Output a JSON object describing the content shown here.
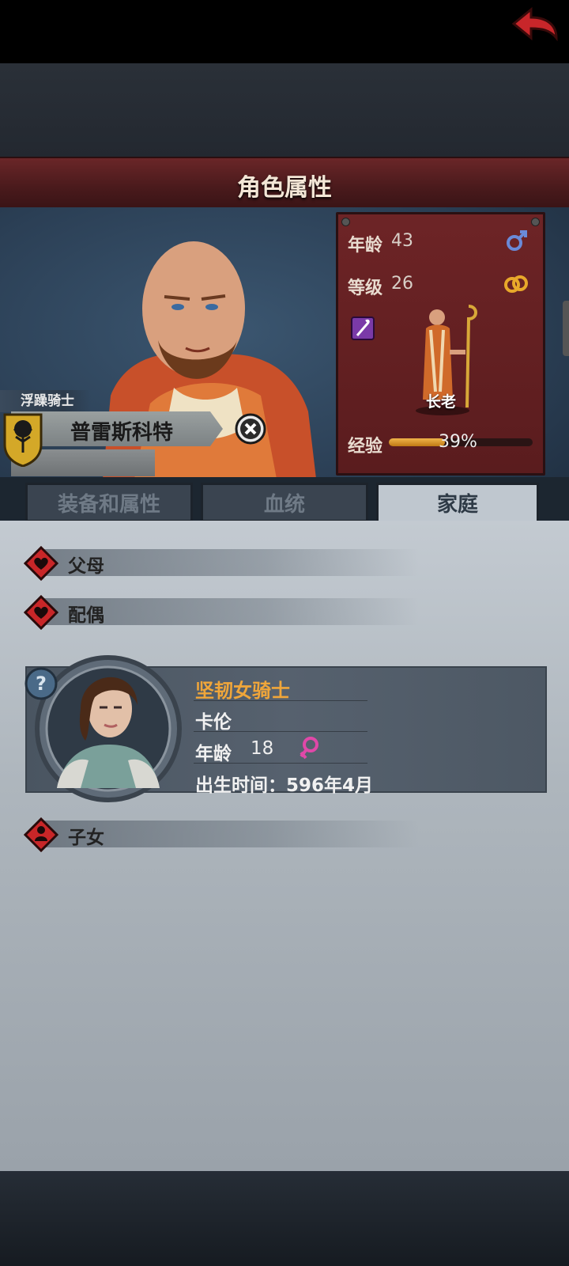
{
  "header": {
    "title": "角色属性",
    "back_icon": "back-arrow-icon"
  },
  "character": {
    "title": "浮躁骑士",
    "name": "普雷斯科特",
    "class": "长老",
    "age_label": "年龄",
    "age": "43",
    "level_label": "等级",
    "level": "26",
    "gender_icon": "male-icon",
    "marital_icon": "rings-icon",
    "staff_icon": "staff-icon",
    "exp_label": "经验",
    "exp_text": "39%",
    "exp_fraction": 0.39
  },
  "tabs": [
    {
      "label": "装备和属性",
      "active": false
    },
    {
      "label": "血统",
      "active": false
    },
    {
      "label": "家庭",
      "active": true
    }
  ],
  "family": {
    "parents_label": "父母",
    "spouse_label": "配偶",
    "children_label": "子女",
    "spouse": {
      "title": "坚韧女骑士",
      "name": "卡伦",
      "age_label": "年龄",
      "age": "18",
      "gender_icon": "female-icon",
      "birth": "出生时间：596年4月"
    }
  },
  "colors": {
    "header": "#5a1c1e",
    "accent_orange": "#f0a63a",
    "content_bg": "#aeb6bd"
  }
}
